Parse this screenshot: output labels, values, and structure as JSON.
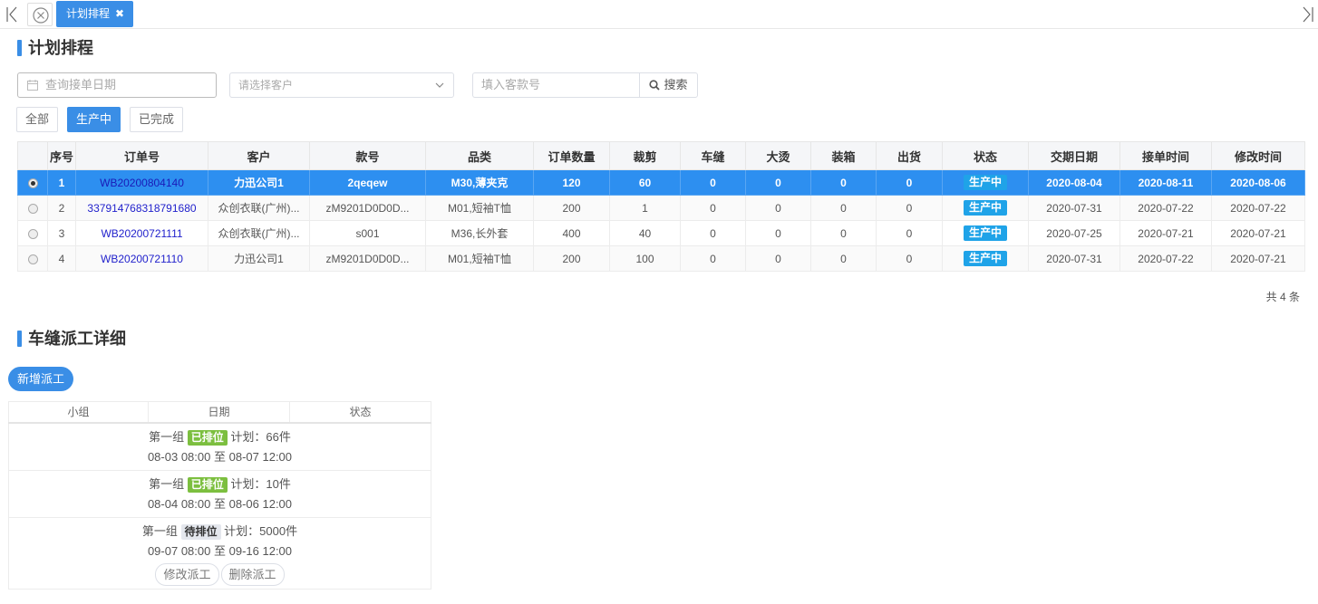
{
  "tabbar": {
    "active_tab_label": "计划排程"
  },
  "plan_section": {
    "title": "计划排程"
  },
  "filters": {
    "date_placeholder": "查询接单日期",
    "customer_placeholder": "请选择客户",
    "style_placeholder": "填入客款号",
    "search_label": "搜索"
  },
  "status_filters": [
    {
      "label": "全部",
      "active": false
    },
    {
      "label": "生产中",
      "active": true
    },
    {
      "label": "已完成",
      "active": false
    }
  ],
  "orders_table": {
    "columns": [
      "",
      "序号",
      "订单号",
      "客户",
      "款号",
      "品类",
      "订单数量",
      "裁剪",
      "车缝",
      "大烫",
      "装箱",
      "出货",
      "状态",
      "交期日期",
      "接单时间",
      "修改时间"
    ],
    "rows": [
      {
        "selected": true,
        "index": "1",
        "order_no": "WB20200804140",
        "customer": "力迅公司1",
        "style": "2qeqew",
        "category": "M30,薄夹克",
        "qty": "120",
        "cut": "60",
        "sew": "0",
        "iron": "0",
        "pack": "0",
        "ship": "0",
        "status": "生产中",
        "due": "2020-08-04",
        "received": "2020-08-11",
        "modified": "2020-08-06"
      },
      {
        "selected": false,
        "index": "2",
        "order_no": "337914768318791680",
        "customer": "众创衣联(广州)...",
        "style": "zM9201D0D0D...",
        "category": "M01,短袖T恤",
        "qty": "200",
        "cut": "1",
        "sew": "0",
        "iron": "0",
        "pack": "0",
        "ship": "0",
        "status": "生产中",
        "due": "2020-07-31",
        "received": "2020-07-22",
        "modified": "2020-07-22"
      },
      {
        "selected": false,
        "index": "3",
        "order_no": "WB20200721111",
        "customer": "众创衣联(广州)...",
        "style": "s001",
        "category": "M36,长外套",
        "qty": "400",
        "cut": "40",
        "sew": "0",
        "iron": "0",
        "pack": "0",
        "ship": "0",
        "status": "生产中",
        "due": "2020-07-25",
        "received": "2020-07-21",
        "modified": "2020-07-21"
      },
      {
        "selected": false,
        "index": "4",
        "order_no": "WB20200721110",
        "customer": "力迅公司1",
        "style": "zM9201D0D0D...",
        "category": "M01,短袖T恤",
        "qty": "200",
        "cut": "100",
        "sew": "0",
        "iron": "0",
        "pack": "0",
        "ship": "0",
        "status": "生产中",
        "due": "2020-07-31",
        "received": "2020-07-22",
        "modified": "2020-07-21"
      }
    ],
    "total_label": "共 4 条"
  },
  "dispatch_section": {
    "title": "车缝派工详细",
    "add_button_label": "新增派工",
    "columns": [
      "小组",
      "日期",
      "状态"
    ],
    "rows": [
      {
        "group": "第一组",
        "status": "已排位",
        "status_style": "green",
        "plan": "计划：66件",
        "start": "08-03 08:00",
        "to": "至",
        "end": "08-07 12:00"
      },
      {
        "group": "第一组",
        "status": "已排位",
        "status_style": "green",
        "plan": "计划：10件",
        "start": "08-04 08:00",
        "to": "至",
        "end": "08-06 12:00"
      },
      {
        "group": "第一组",
        "status": "待排位",
        "status_style": "gray",
        "plan": "计划：5000件",
        "start": "09-07 08:00",
        "to": "至",
        "end": "09-16 12:00"
      }
    ],
    "edit_label": "修改派工",
    "delete_label": "删除派工"
  },
  "colors": {
    "accent": "#3a8ee6",
    "status_blue": "#1fa3e8",
    "tag_green": "#7cbf3f"
  }
}
